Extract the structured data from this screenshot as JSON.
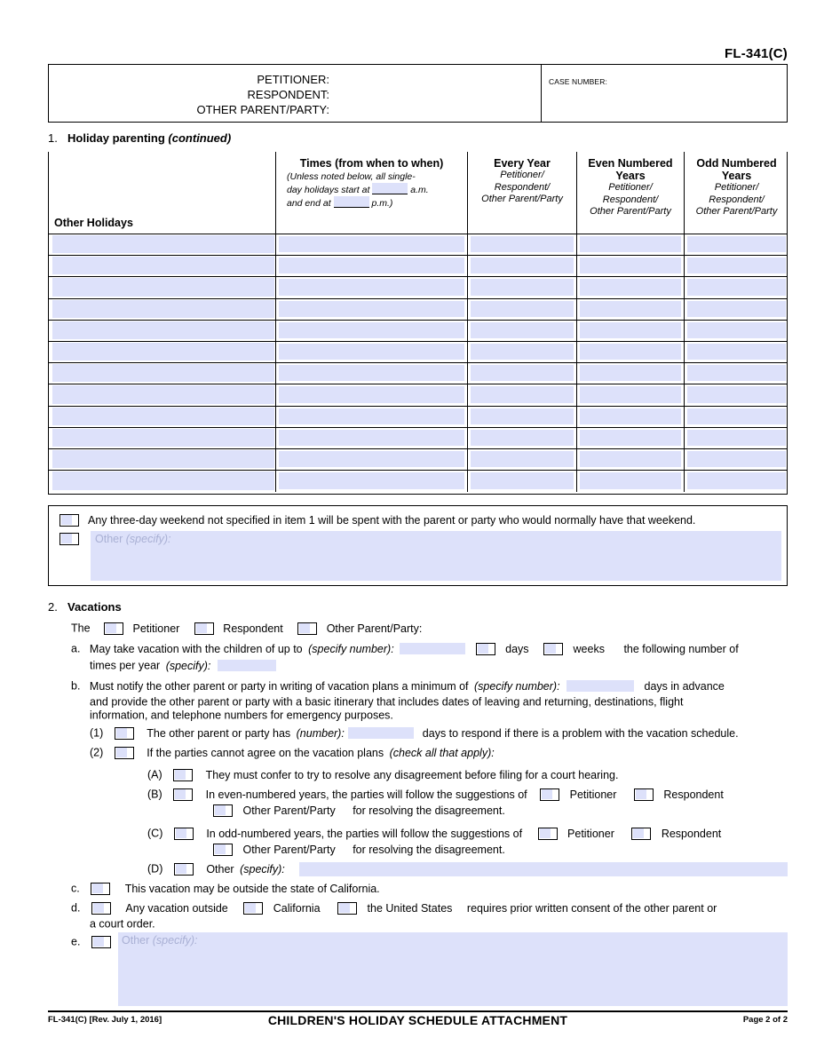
{
  "form": {
    "number": "FL-341(C)",
    "footer_left": "FL-341(C) [Rev. July 1, 2016]",
    "footer_title": "CHILDREN'S HOLIDAY SCHEDULE ATTACHMENT",
    "footer_right": "Page 2 of 2"
  },
  "caption": {
    "petitioner_label": "PETITIONER:",
    "respondent_label": "RESPONDENT:",
    "other_parent_label": "OTHER PARENT/PARTY:",
    "case_number_label": "CASE NUMBER:"
  },
  "item1": {
    "number": "1.",
    "title": "Holiday parenting",
    "continued": "(continued)",
    "table": {
      "col_other_holidays": "Other Holidays",
      "col_times_title": "Times (from when to when)",
      "col_times_note_1": "(Unless noted below, all single-",
      "col_times_note_2a": "day holidays start at",
      "col_times_note_2b": "a.m.",
      "col_times_note_3a": "and end at",
      "col_times_note_3b": "p.m.)",
      "col_every_year_title": "Every Year",
      "col_even_title_1": "Even Numbered",
      "col_even_title_2": "Years",
      "col_odd_title_1": "Odd Numbered",
      "col_odd_title_2": "Years",
      "party_line_1": "Petitioner/",
      "party_line_2": "Respondent/",
      "party_line_3": "Other Parent/Party",
      "row_count": 12
    },
    "notes": {
      "three_day_weekend": "Any three-day weekend not specified in item 1 will be spent with the parent or party who would normally have that weekend.",
      "other_label": "Other",
      "other_specify": "(specify):"
    }
  },
  "item2": {
    "number": "2.",
    "title": "Vacations",
    "the_label": "The",
    "petitioner": "Petitioner",
    "respondent": "Respondent",
    "other_parent_party_colon": "Other Parent/Party:",
    "a": {
      "marker": "a.",
      "text_1": "May take vacation with the children of up to",
      "specify_number": "(specify number):",
      "days": "days",
      "weeks": "weeks",
      "text_2": "the following number of",
      "text_3": "times per year",
      "specify": "(specify):"
    },
    "b": {
      "marker": "b.",
      "text_1": "Must notify the other parent or party in writing of vacation plans a minimum of",
      "specify_number": "(specify number):",
      "text_2": "days in advance",
      "text_3": "and provide the other parent or party with a basic itinerary that includes dates of leaving and returning, destinations, flight",
      "text_4": "information, and telephone numbers for emergency purposes.",
      "sub1": {
        "marker": "(1)",
        "text_1": "The other parent or party has",
        "number": "(number):",
        "text_2": "days to respond if there is a problem with the vacation schedule."
      },
      "sub2": {
        "marker": "(2)",
        "text_1": "If the parties cannot agree on the vacation plans",
        "check_all": "(check all that apply):",
        "A": {
          "marker": "(A)",
          "text": "They must confer to try to resolve any disagreement before filing for a court hearing."
        },
        "B": {
          "marker": "(B)",
          "text_1": "In even-numbered years, the parties will follow the suggestions of",
          "petitioner": "Petitioner",
          "respondent": "Respondent",
          "other_parent_party": "Other Parent/Party",
          "text_2": "for resolving the disagreement."
        },
        "C": {
          "marker": "(C)",
          "text_1": "In odd-numbered years, the parties will follow the suggestions of",
          "petitioner": "Petitioner",
          "respondent": "Respondent",
          "other_parent_party": "Other Parent/Party",
          "text_2": "for resolving the disagreement."
        },
        "D": {
          "marker": "(D)",
          "other": "Other",
          "specify": "(specify):"
        }
      }
    },
    "c": {
      "marker": "c.",
      "text": "This vacation may be outside the state of California."
    },
    "d": {
      "marker": "d.",
      "text_1": "Any vacation outside",
      "california": "California",
      "united_states": "the United States",
      "text_2": "requires prior written consent of the other parent or",
      "text_3": "a court order."
    },
    "e": {
      "marker": "e.",
      "other": "Other",
      "specify": "(specify):"
    }
  },
  "colors": {
    "fill": "#dde1fa",
    "placeholder_text": "#a9b0d4",
    "rule": "#000000"
  }
}
